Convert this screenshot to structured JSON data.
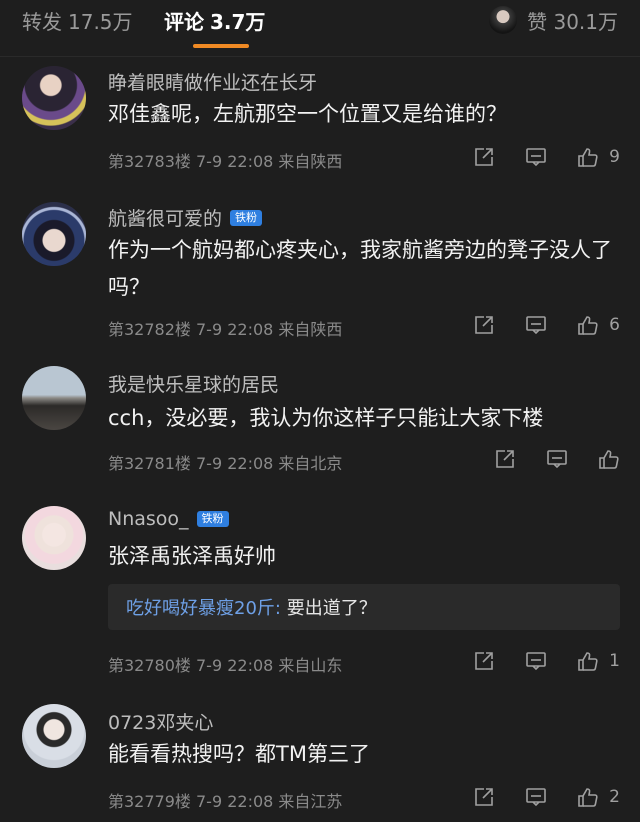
{
  "header": {
    "repost_label": "转发",
    "repost_count": "17.5万",
    "comments_label": "评论",
    "comments_count": "3.7万",
    "likes_label": "赞",
    "likes_count": "30.1万"
  },
  "comments": [
    {
      "username": "睁着眼睛做作业还在长牙",
      "badge": "",
      "text": "邓佳鑫呢，左航那空一个位置又是给谁的？",
      "meta": "第32783楼 7-9 22:08 来自陕西",
      "likes": "9"
    },
    {
      "username": "航酱很可爱的",
      "badge": "铁粉",
      "text": "作为一个航妈都心疼夹心，我家航酱旁边的凳子没人了吗？",
      "meta": "第32782楼 7-9 22:08 来自陕西",
      "likes": "6"
    },
    {
      "username": "我是快乐星球的居民",
      "badge": "",
      "text": "cch，没必要，我认为你这样子只能让大家下楼",
      "meta": "第32781楼 7-9 22:08 来自北京",
      "likes": ""
    },
    {
      "username": "Nnasoo_",
      "badge": "铁粉",
      "text": "张泽禹张泽禹好帅",
      "reply_user": "吃好喝好暴瘦20斤:",
      "reply_text": " 要出道了？",
      "meta": "第32780楼 7-9 22:08 来自山东",
      "likes": "1"
    },
    {
      "username": "0723邓夹心",
      "badge": "",
      "text": "能看看热搜吗？都TM第三了",
      "meta": "第32779楼 7-9 22:08 来自江苏",
      "likes": "2"
    }
  ]
}
